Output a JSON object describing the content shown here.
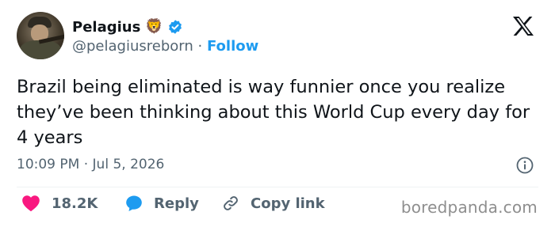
{
  "author": {
    "display_name": "Pelagius",
    "emoji": "🦁",
    "handle": "@pelagiusreborn",
    "separator": "·",
    "follow_label": "Follow"
  },
  "tweet": {
    "text": "Brazil being eliminated is way funnier once you realize they’ve been thinking about this World Cup every day for 4 years",
    "timestamp": "10:09 PM · Jul 5, 2026"
  },
  "actions": {
    "likes_count": "18.2K",
    "reply_label": "Reply",
    "copy_link_label": "Copy link"
  },
  "watermark": "boredpanda.com",
  "colors": {
    "text": "#0f1419",
    "secondary": "#536471",
    "accent": "#1d9bf0",
    "like": "#f91880",
    "verified": "#1d9bf0"
  },
  "icons": [
    "verified-badge-icon",
    "x-logo-icon",
    "info-icon",
    "heart-icon",
    "reply-bubble-icon",
    "link-icon"
  ]
}
